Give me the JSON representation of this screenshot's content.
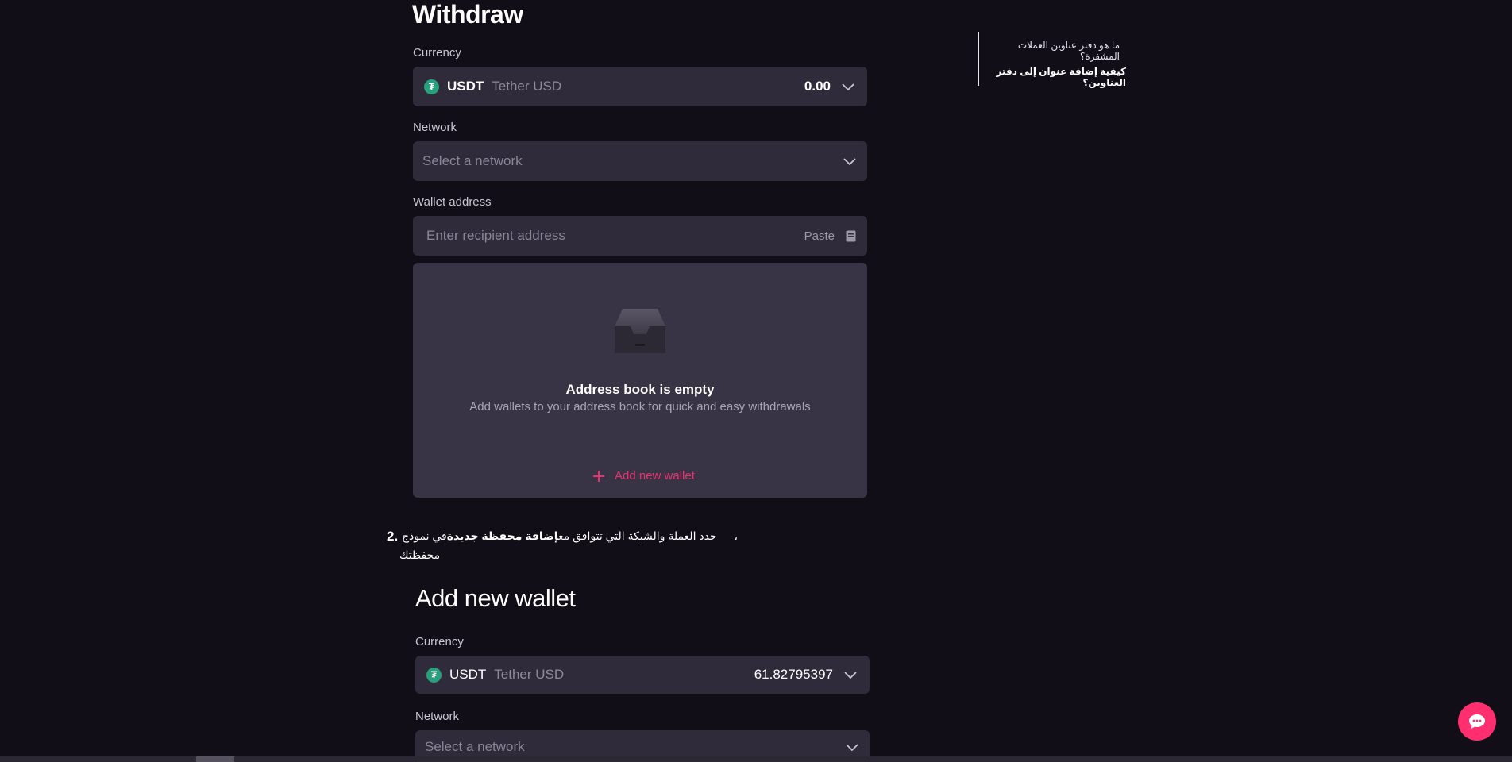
{
  "withdraw": {
    "title": "Withdraw",
    "currency_label": "Currency",
    "currency": {
      "symbol": "USDT",
      "name": "Tether USD",
      "balance": "0.00",
      "coin_glyph": "₮"
    },
    "network_label": "Network",
    "network_placeholder": "Select a network",
    "address_label": "Wallet address",
    "address_placeholder": "Enter recipient address",
    "paste_label": "Paste",
    "address_book": {
      "title": "Address book is empty",
      "subtitle": "Add wallets to your address book for quick and easy withdrawals",
      "add_label": "Add new wallet"
    }
  },
  "step2": {
    "number": "2.",
    "text_before": "حدد العملة والشبكة التي تتوافق مع",
    "text_bold": "إضافة محفظة جديدة",
    "text_after": "في نموذج",
    "text_trailing": "،",
    "text_line2": "محفظتك"
  },
  "add_wallet": {
    "title": "Add new wallet",
    "currency_label": "Currency",
    "currency": {
      "symbol": "USDT",
      "name": "Tether USD",
      "balance": "61.82795397",
      "coin_glyph": "₮"
    },
    "network_label": "Network",
    "network_placeholder": "Select a network"
  },
  "toc": {
    "items": [
      {
        "label": "ما هو دفتر عناوين العملات المشفرة؟"
      },
      {
        "label": "كيفية إضافة عنوان إلى دفتر العناوين؟"
      }
    ]
  },
  "colors": {
    "background": "#110e18",
    "field": "#2f2b3a",
    "accent": "#e6326e",
    "usdt": "#26a17b",
    "chat": "#ff2e6e"
  },
  "icons": {
    "chevron": "chevron-down-icon",
    "clipboard": "clipboard-icon",
    "plus": "plus-icon",
    "inbox": "inbox-icon",
    "chat": "chat-icon"
  }
}
